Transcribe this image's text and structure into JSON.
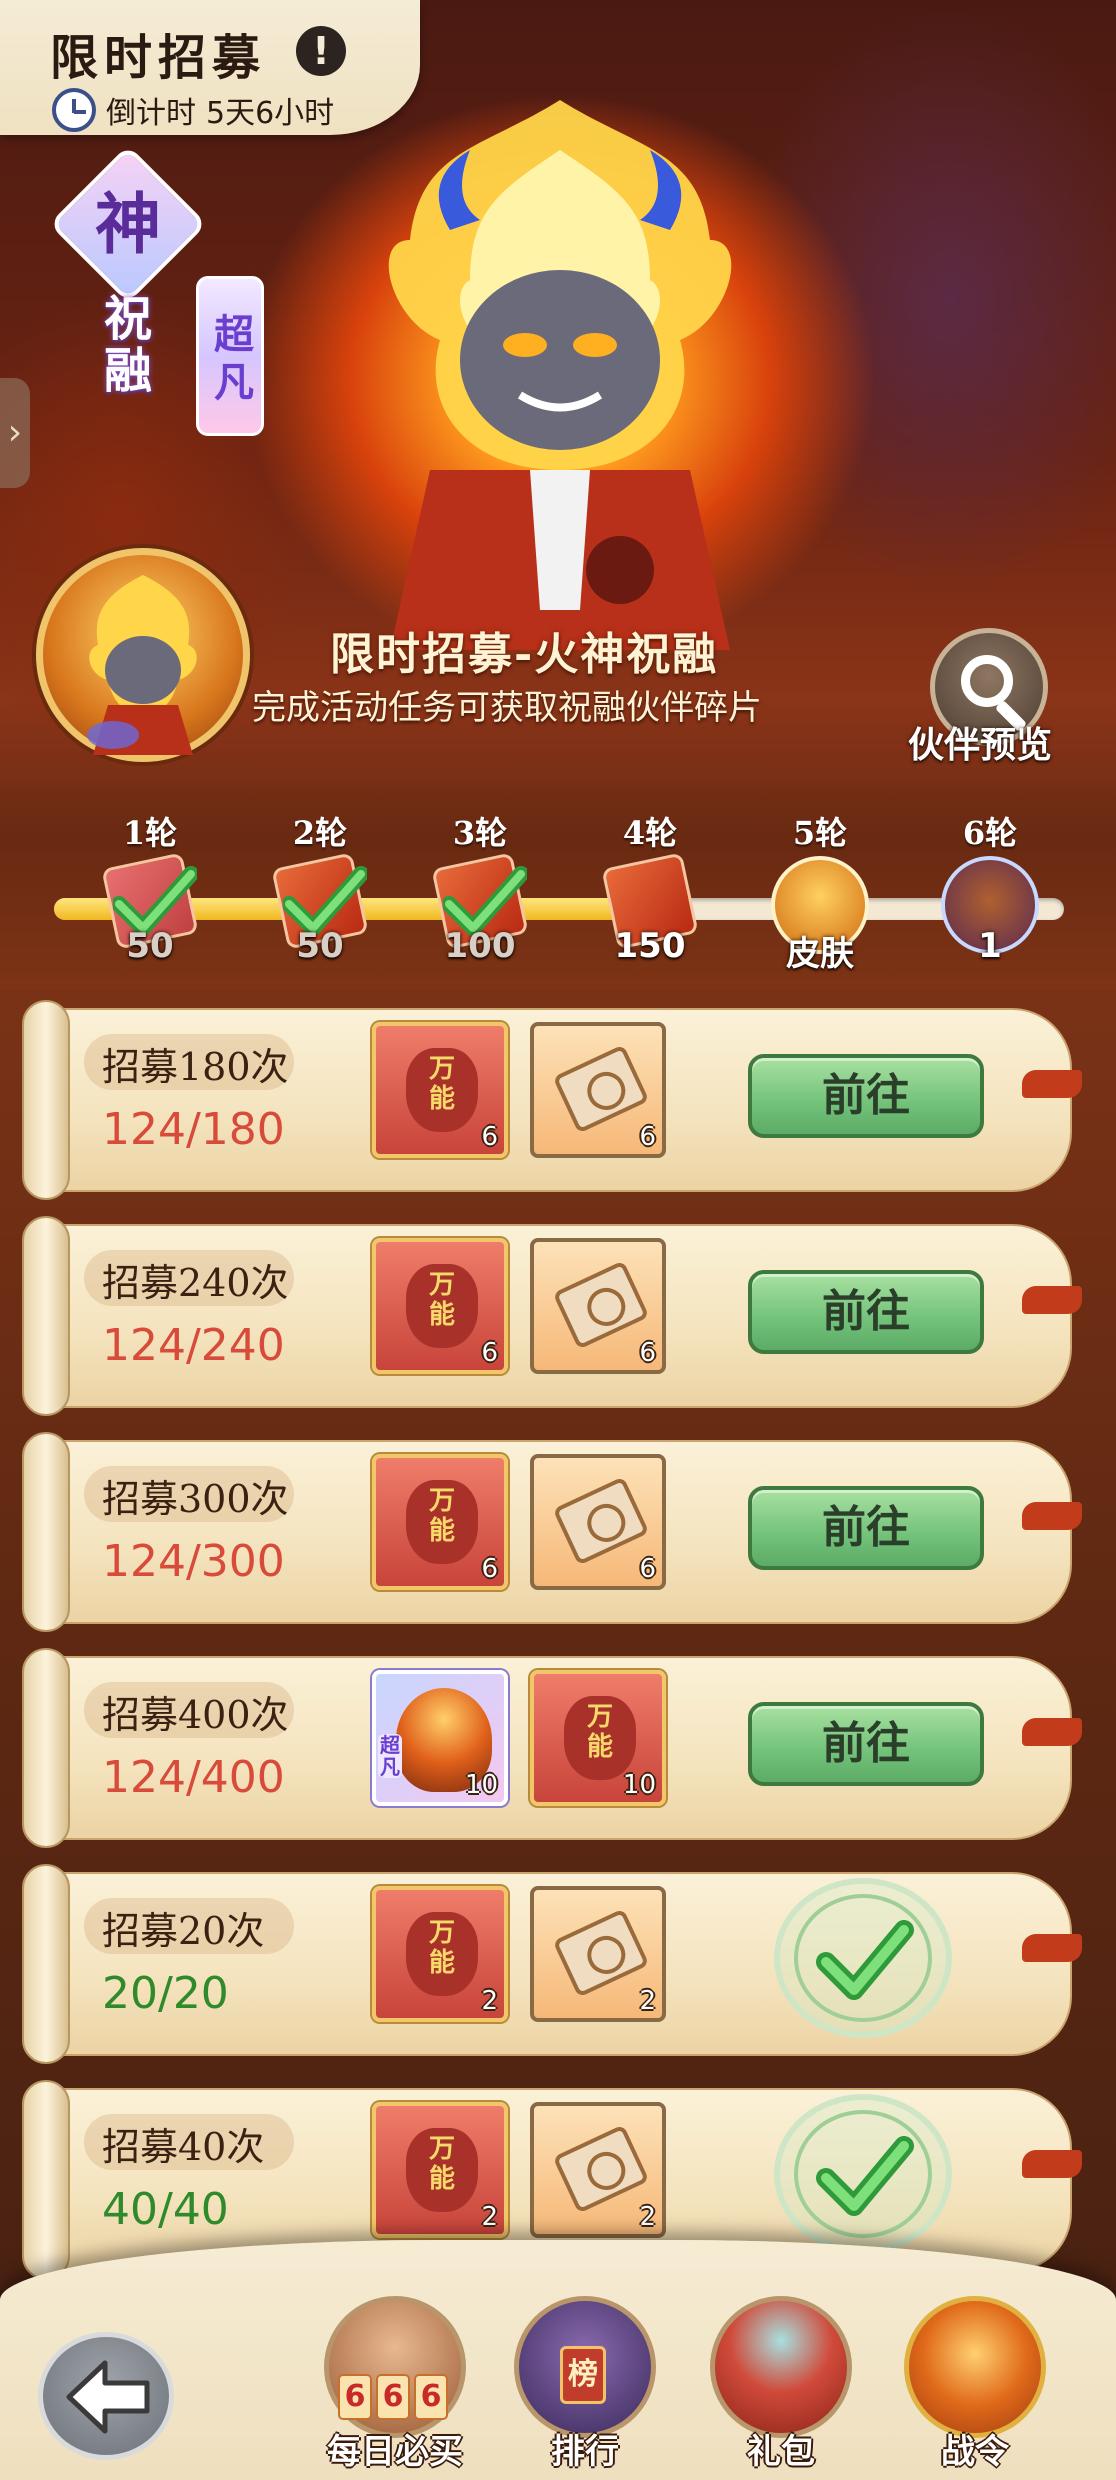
{
  "header": {
    "title": "限时招募",
    "info_icon": "!",
    "countdown_label": "倒计时",
    "countdown_value": "5天6小时"
  },
  "hero_badges": {
    "grade": "神",
    "type": "祝融",
    "rarity": "超凡"
  },
  "event": {
    "title": "限时招募-火神祝融",
    "description": "完成活动任务可获取祝融伙伴碎片",
    "preview_label": "伙伴预览"
  },
  "rounds": {
    "progress": 0.6,
    "items": [
      {
        "label": "1轮",
        "amount": "50",
        "claimed": true
      },
      {
        "label": "2轮",
        "amount": "50",
        "claimed": true
      },
      {
        "label": "3轮",
        "amount": "100",
        "claimed": true
      },
      {
        "label": "4轮",
        "amount": "150",
        "claimed": false
      },
      {
        "label": "5轮",
        "amount": "皮肤",
        "claimed": false
      },
      {
        "label": "6轮",
        "amount": "1",
        "claimed": false
      }
    ]
  },
  "item_labels": {
    "wild": "万能",
    "hero_tag": "超凡"
  },
  "tasks": [
    {
      "name": "招募180次",
      "progress": "124/180",
      "done": false,
      "rewards": [
        {
          "type": "wild",
          "count": "6"
        },
        {
          "type": "scroll",
          "count": "6"
        }
      ],
      "action": "前往"
    },
    {
      "name": "招募240次",
      "progress": "124/240",
      "done": false,
      "rewards": [
        {
          "type": "wild",
          "count": "6"
        },
        {
          "type": "scroll",
          "count": "6"
        }
      ],
      "action": "前往"
    },
    {
      "name": "招募300次",
      "progress": "124/300",
      "done": false,
      "rewards": [
        {
          "type": "wild",
          "count": "6"
        },
        {
          "type": "scroll",
          "count": "6"
        }
      ],
      "action": "前往"
    },
    {
      "name": "招募400次",
      "progress": "124/400",
      "done": false,
      "rewards": [
        {
          "type": "hero",
          "count": "10"
        },
        {
          "type": "wild",
          "count": "10"
        }
      ],
      "action": "前往"
    },
    {
      "name": "招募20次",
      "progress": "20/20",
      "done": true,
      "rewards": [
        {
          "type": "wild",
          "count": "2"
        },
        {
          "type": "scroll",
          "count": "2"
        }
      ],
      "action": ""
    },
    {
      "name": "招募40次",
      "progress": "40/40",
      "done": true,
      "rewards": [
        {
          "type": "wild",
          "count": "2"
        },
        {
          "type": "scroll",
          "count": "2"
        }
      ],
      "action": ""
    }
  ],
  "dock": {
    "daily_cards": [
      "6",
      "6",
      "6"
    ],
    "rank_sign": "榜",
    "items": [
      {
        "label": "每日必买",
        "icon": "daily-deal-icon"
      },
      {
        "label": "排行",
        "icon": "ranking-icon"
      },
      {
        "label": "礼包",
        "icon": "gift-bag-icon"
      },
      {
        "label": "战令",
        "icon": "battle-pass-icon"
      }
    ]
  },
  "colors": {
    "go_button": "#72c27a",
    "progress_pending": "#d84a3a",
    "progress_done": "#2e8a2a",
    "scroll_paper": "#f4e3bd"
  }
}
